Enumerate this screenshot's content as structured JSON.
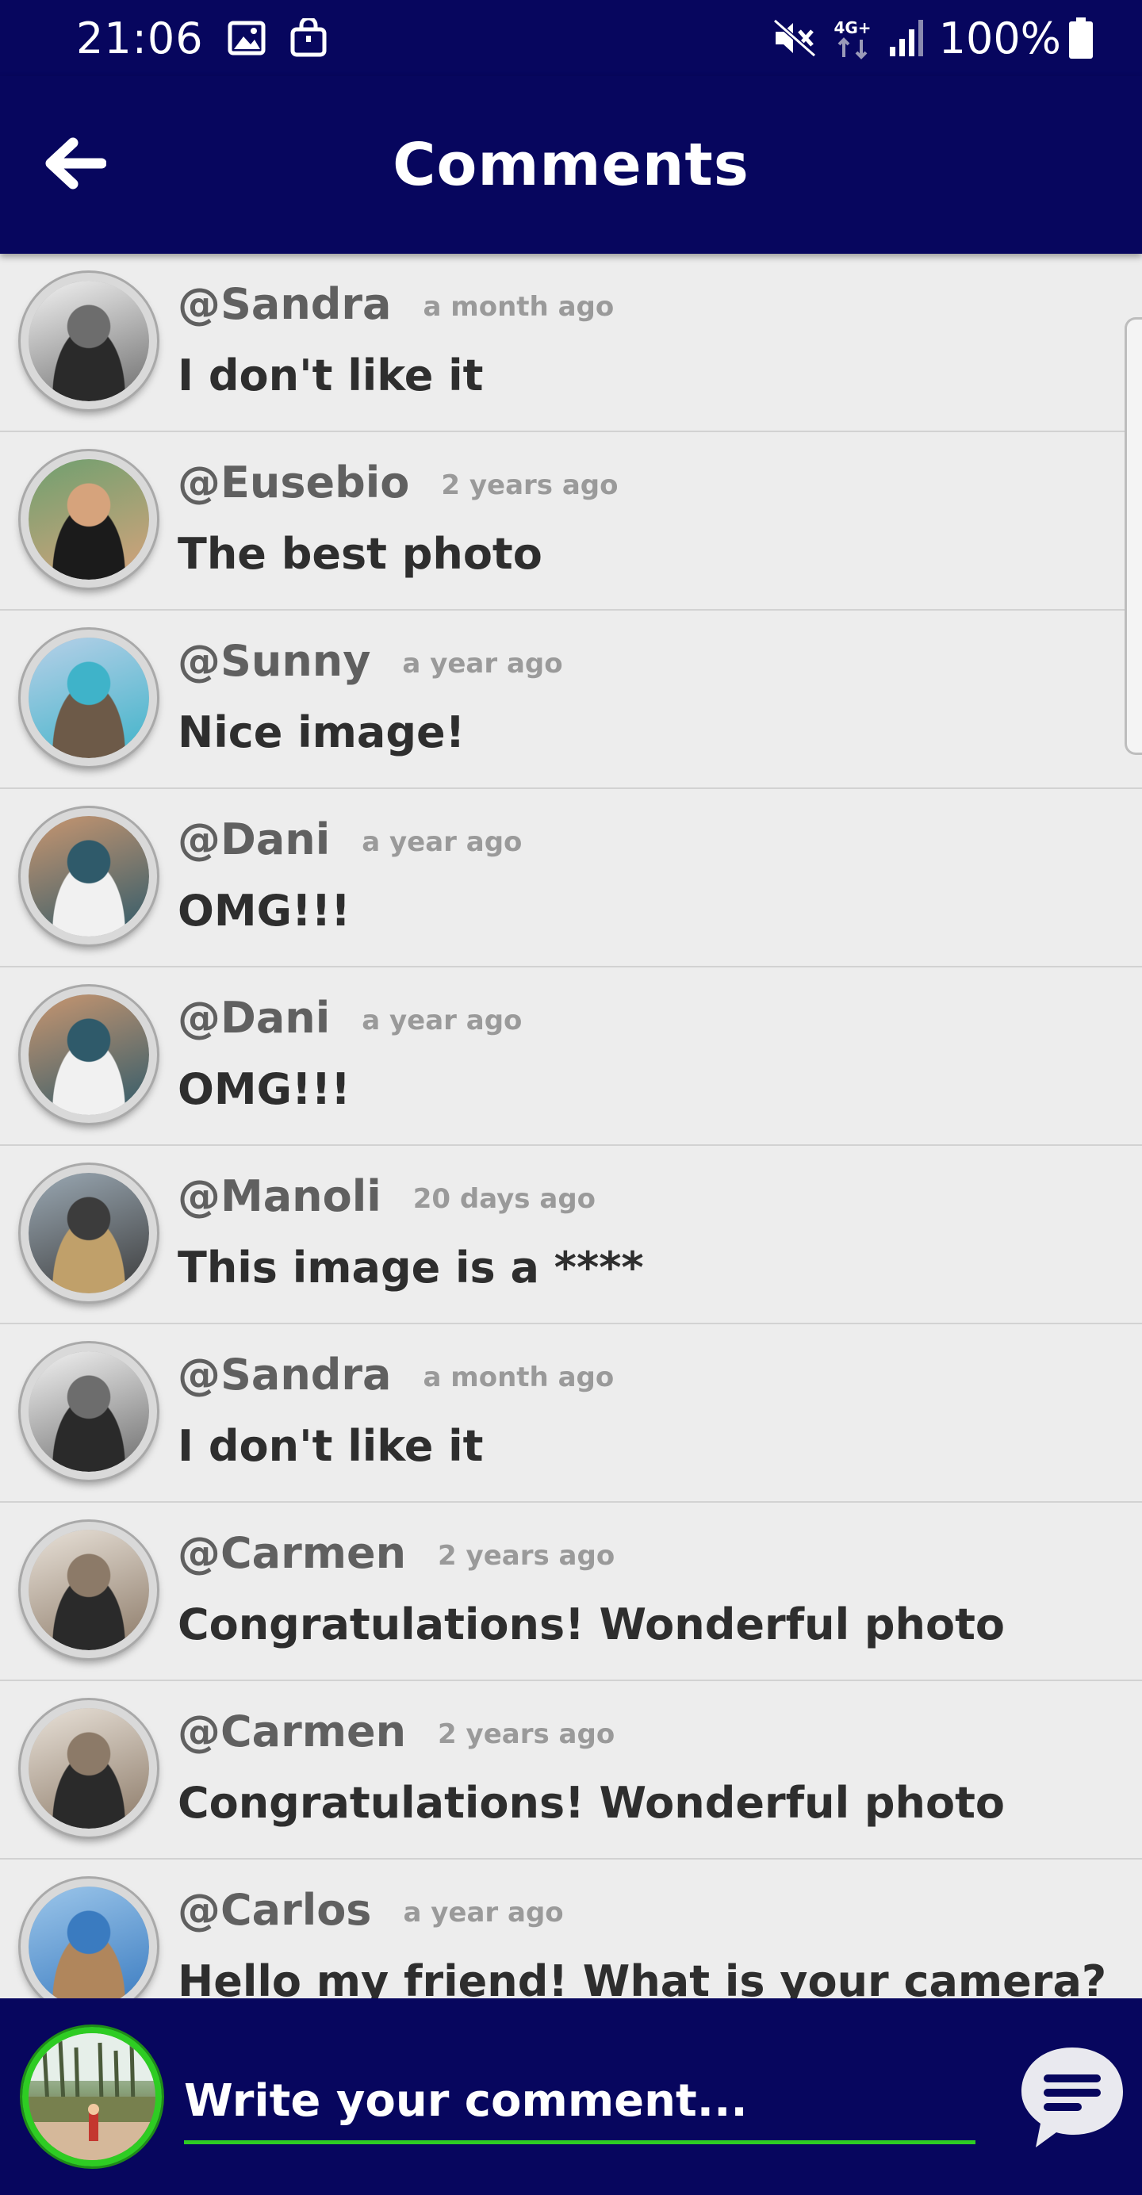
{
  "status_bar": {
    "time": "21:06",
    "network": "4G+",
    "battery": "100%",
    "icons": [
      "image-icon",
      "shopping-bag-icon",
      "mute-icon",
      "network-4g-icon",
      "signal-icon",
      "battery-icon"
    ]
  },
  "header": {
    "title": "Comments",
    "back_icon": "arrow-left-icon"
  },
  "comments": [
    {
      "user": "@Sandra",
      "time": "a month ago",
      "text": "I don't like it"
    },
    {
      "user": "@Eusebio",
      "time": "2 years ago",
      "text": "The best photo"
    },
    {
      "user": "@Sunny",
      "time": "a year ago",
      "text": "Nice image!"
    },
    {
      "user": "@Dani",
      "time": "a year ago",
      "text": "OMG!!!"
    },
    {
      "user": "@Dani",
      "time": "a year ago",
      "text": "OMG!!!"
    },
    {
      "user": "@Manoli",
      "time": "20 days ago",
      "text": "This image is a ****"
    },
    {
      "user": "@Sandra",
      "time": "a month ago",
      "text": "I don't like it"
    },
    {
      "user": "@Carmen",
      "time": "2 years ago",
      "text": "Congratulations! Wonderful photo"
    },
    {
      "user": "@Carmen",
      "time": "2 years ago",
      "text": "Congratulations! Wonderful photo"
    },
    {
      "user": "@Carlos",
      "time": "a year ago",
      "text": "Hello my friend! What is your camera?"
    }
  ],
  "composer": {
    "placeholder": "Write your comment...",
    "send_icon": "chat-bubble-icon"
  },
  "colors": {
    "primary": "#07065e",
    "accent": "#2ecc23",
    "background": "#ededed"
  }
}
